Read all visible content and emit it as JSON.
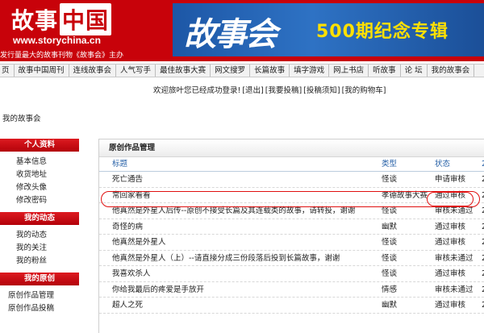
{
  "header": {
    "logo_part1": "故事",
    "logo_part2": "中国",
    "logo_url": "www.storychina.cn",
    "logo_slogan": "发行量最大的故事刊物《故事会》主办",
    "banner_brush": "故事会",
    "banner_subtitle": "500期纪念专辑"
  },
  "nav": {
    "items": [
      "页",
      "故事中国周刊",
      "连线故事会",
      "人气写手",
      "最佳故事大赛",
      "网文搜罗",
      "长篇故事",
      "填字游戏",
      "网上书店",
      "听故事",
      "论 坛",
      "我的故事会"
    ]
  },
  "welcome": {
    "message": "欢迎旅叶您已经成功登录!",
    "links": [
      "[退出]",
      "[我要投稿]",
      "[投稿须知]",
      "[我的购物车]"
    ]
  },
  "breadcrumb": "我的故事会",
  "sidebar": {
    "groups": [
      {
        "title": "个人资料",
        "items": [
          "基本信息",
          "收货地址",
          "修改头像",
          "修改密码"
        ]
      },
      {
        "title": "我的动态",
        "items": [
          "我的动态",
          "我的关注",
          "我的粉丝"
        ]
      },
      {
        "title": "我的原创",
        "items": [
          "原创作品管理",
          "原创作品投稿"
        ]
      }
    ]
  },
  "main": {
    "title": "原创作品管理",
    "columns": {
      "title": "标题",
      "type": "类型",
      "status": "状态",
      "date": "2"
    },
    "rows": [
      {
        "title": "死亡通告",
        "type": "怪谈",
        "status": "申请审核",
        "date": "2"
      },
      {
        "title": "常回家看看",
        "type": "孝德故事大赛",
        "status": "通过审核",
        "date": "2"
      },
      {
        "title": "他真然是外星人后传--原创不接受长篇及其连载类的故事，请转投，谢谢",
        "type": "怪谈",
        "status": "审核未通过",
        "date": "2"
      },
      {
        "title": "奇怪的病",
        "type": "幽默",
        "status": "通过审核",
        "date": "2"
      },
      {
        "title": "他真然是外星人",
        "type": "怪谈",
        "status": "通过审核",
        "date": "2"
      },
      {
        "title": "他真然是外星人（上）--请直接分成三份段落后投到长篇故事，谢谢",
        "type": "怪谈",
        "status": "审核未通过",
        "date": "2"
      },
      {
        "title": "我喜欢杀人",
        "type": "怪谈",
        "status": "通过审核",
        "date": "2"
      },
      {
        "title": "你给我最后的疼爱是手放开",
        "type": "情感",
        "status": "审核未通过",
        "date": "2"
      },
      {
        "title": "超人之死",
        "type": "幽默",
        "status": "通过审核",
        "date": "2"
      }
    ]
  },
  "colors": {
    "brand_red": "#c8020a",
    "banner_blue": "#1d57a6",
    "banner_yellow": "#ffe000",
    "header_link_blue": "#2a63a8",
    "highlight_red": "#e01010"
  }
}
